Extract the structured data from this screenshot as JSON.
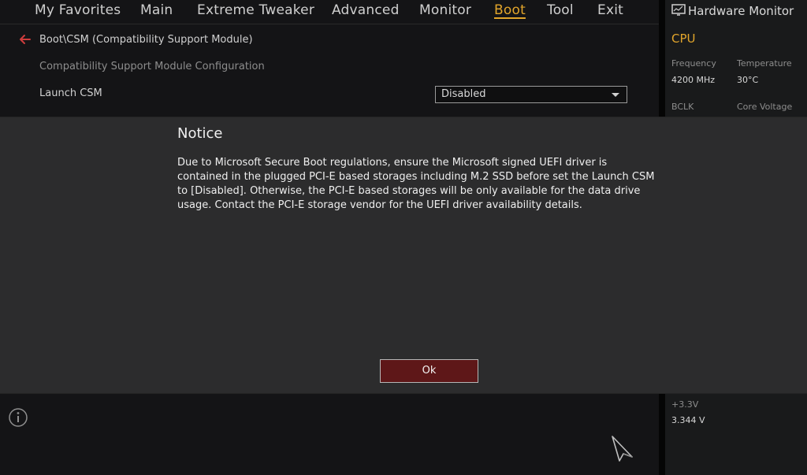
{
  "top_nav": {
    "items": [
      {
        "label": "My Favorites"
      },
      {
        "label": "Main"
      },
      {
        "label": "Extreme Tweaker"
      },
      {
        "label": "Advanced"
      },
      {
        "label": "Monitor"
      },
      {
        "label": "Boot"
      },
      {
        "label": "Tool"
      },
      {
        "label": "Exit"
      }
    ],
    "active": "Boot"
  },
  "breadcrumb": {
    "path": "Boot\\CSM (Compatibility Support Module)"
  },
  "content": {
    "section_header": "Compatibility Support Module Configuration",
    "settings": [
      {
        "label": "Launch CSM",
        "value": "Disabled"
      }
    ]
  },
  "notice": {
    "title": "Notice",
    "message": "Due to Microsoft Secure Boot regulations, ensure the Microsoft signed UEFI driver is contained in the plugged PCI-E based storages including M.2 SSD before set the Launch CSM to [Disabled]. Otherwise, the PCI-E based storages will be only available for the data drive usage. Contact the PCI-E storage vendor for the UEFI driver availability details.",
    "ok_label": "Ok"
  },
  "hardware_monitor": {
    "title": "Hardware Monitor",
    "cpu": {
      "heading": "CPU",
      "frequency_label": "Frequency",
      "frequency_value": "4200 MHz",
      "temperature_label": "Temperature",
      "temperature_value": "30°C",
      "bclk_label": "BCLK",
      "core_voltage_label": "Core Voltage"
    },
    "voltage": {
      "plus33_label": "+3.3V",
      "plus33_value": "3.344 V"
    }
  },
  "icons": {
    "back": "back-arrow-icon",
    "monitor": "monitor-icon",
    "info": "info-icon",
    "cursor": "mouse-cursor-icon",
    "dropdown": "chevron-down-icon"
  },
  "colors": {
    "accent": "#e2a52b",
    "button_bg": "#5e1718",
    "panel_bg": "#2c2c2d"
  }
}
